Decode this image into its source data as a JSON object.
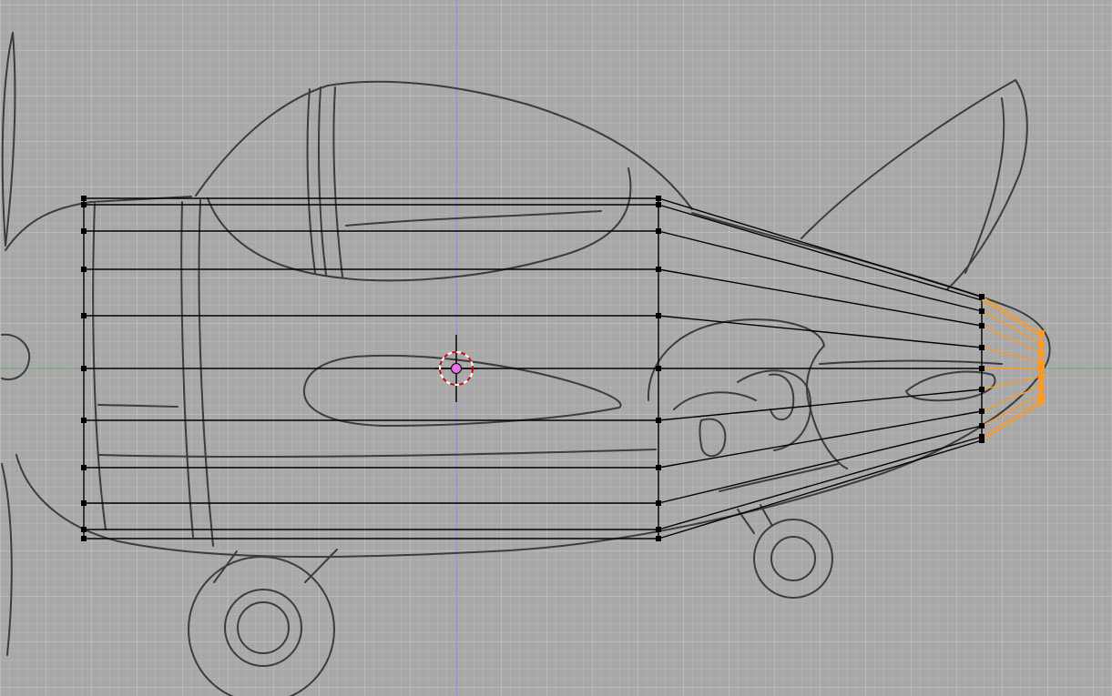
{
  "viewport": {
    "view": "side-orthographic",
    "background_color": "#a8a8a8",
    "grid_minor_color": "#b8b8b8",
    "grid_major_color": "#c2c2c2",
    "axis_x_color": "#6aa86a",
    "axis_z_color": "#7c7ce0",
    "sketch_color": "#3c3c3c",
    "wire_color": "#000000",
    "selection_color": "#ff9a1f",
    "origin_color": "#e870e8",
    "cursor_color": "#d00000",
    "icons": [
      "3d-cursor-icon",
      "object-origin-icon"
    ]
  },
  "mesh": {
    "edge_loops": 4,
    "loop_vertices": 11,
    "selected_loop": 4
  }
}
